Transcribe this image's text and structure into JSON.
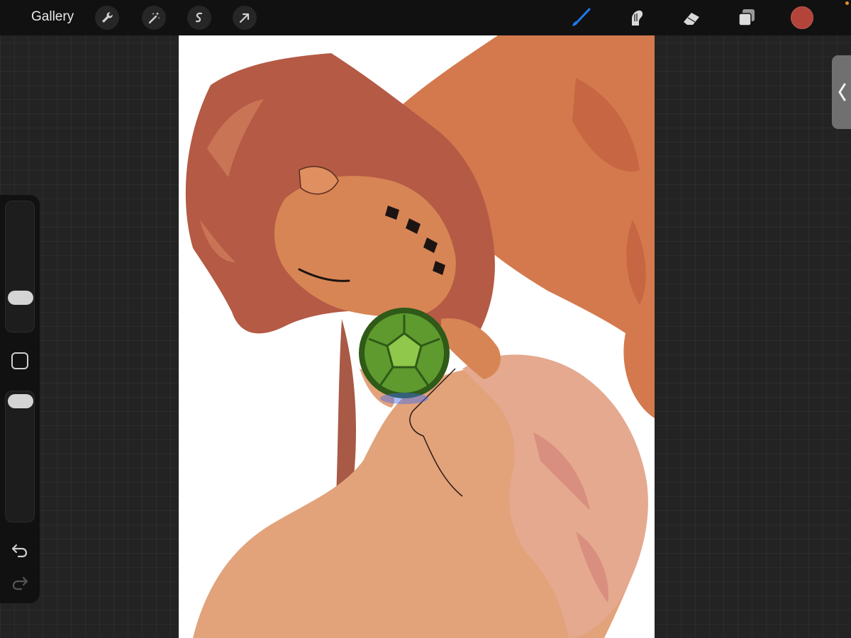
{
  "topbar": {
    "gallery_label": "Gallery",
    "left_tools": [
      {
        "icon": "wrench-icon"
      },
      {
        "icon": "magic-wand-icon"
      },
      {
        "icon": "selection-icon"
      },
      {
        "icon": "transform-arrow-icon"
      }
    ],
    "right_tools": [
      {
        "icon": "brush-icon",
        "active": true,
        "color": "#1f7bf2"
      },
      {
        "icon": "smudge-icon"
      },
      {
        "icon": "eraser-icon"
      },
      {
        "icon": "layers-icon"
      }
    ],
    "current_color": "#b3443a",
    "status_dot_color": "#e0902a"
  },
  "sidebar": {
    "brush_size_level": 0.36,
    "opacity_level": 0.9,
    "modify_icon": "square-icon",
    "undo_icon": "undo-arrow-icon",
    "redo_icon": "redo-arrow-icon"
  },
  "panel_tab_icon": "chevron-left-icon",
  "canvas": {
    "background": "#ffffff",
    "palette": {
      "hood": "#b55a45",
      "skin_orange": "#d3794d",
      "skin_light": "#e2a27a",
      "hair_pale": "#e4a98f",
      "shell_green": "#5e9a2e",
      "ink": "#1c1412"
    }
  }
}
